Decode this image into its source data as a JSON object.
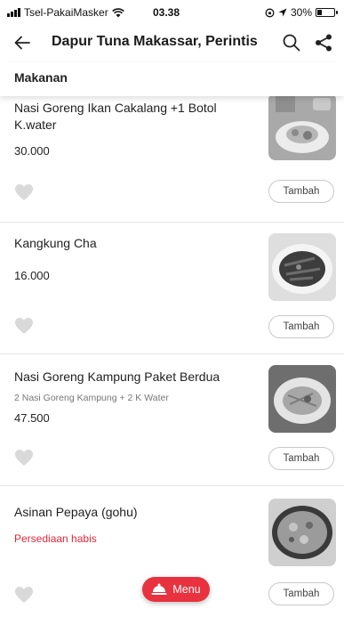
{
  "status_bar": {
    "carrier": "Tsel-PakaiMasker",
    "time": "03.38",
    "battery": "30%",
    "battery_level": 0.3
  },
  "header": {
    "title": "Dapur Tuna Makassar, Perintis",
    "back_icon": "arrow-left-icon",
    "search_icon": "search-icon",
    "share_icon": "share-icon"
  },
  "category": {
    "label": "Makanan"
  },
  "items": [
    {
      "name": "Nasi Goreng Ikan Cakalang +1 Botol K.water",
      "description": "",
      "price": "30.000",
      "status": "",
      "add_label": "Tambah"
    },
    {
      "name": "Kangkung Cha",
      "description": "",
      "price": "16.000",
      "status": "",
      "add_label": "Tambah"
    },
    {
      "name": "Nasi Goreng Kampung Paket Berdua",
      "description": "2 Nasi Goreng Kampung + 2 K Water",
      "price": "47.500",
      "status": "",
      "add_label": "Tambah"
    },
    {
      "name": "Asinan Pepaya (gohu)",
      "description": "",
      "price": "",
      "status": "Persediaan habis",
      "add_label": "Tambah"
    }
  ],
  "menu_button": {
    "label": "Menu",
    "icon": "cloche-icon"
  },
  "colors": {
    "accent": "#e8323f",
    "sold_out": "#e0263a",
    "heart": "#d9d9d9"
  }
}
